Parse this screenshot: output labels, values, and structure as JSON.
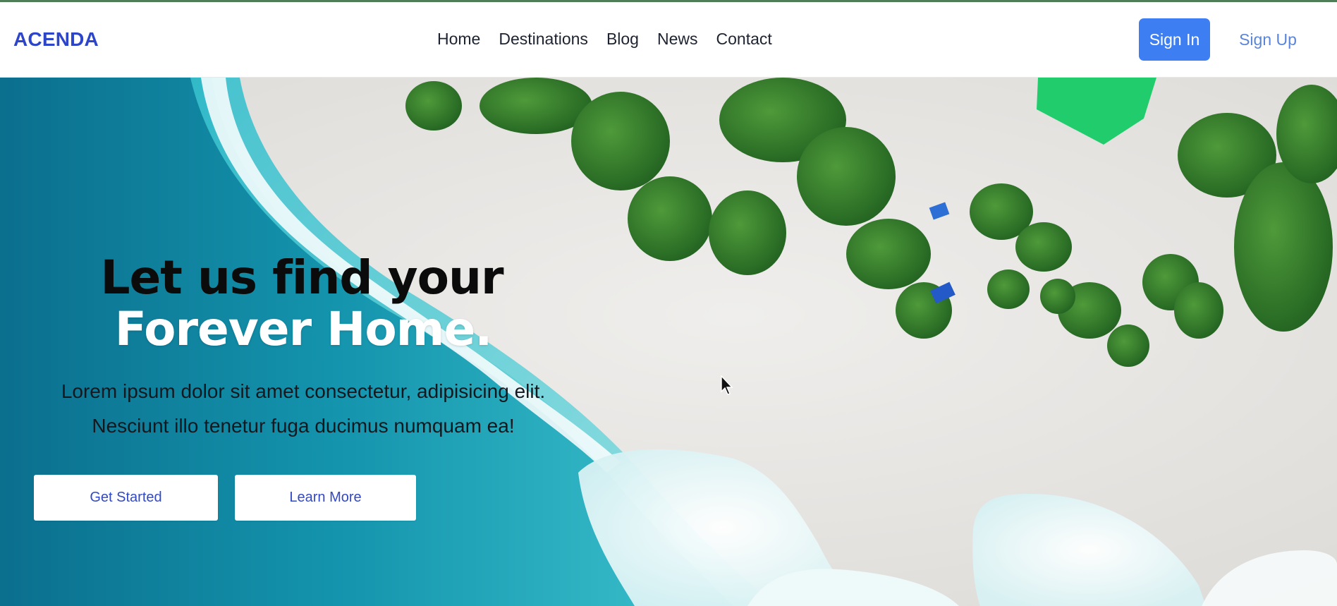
{
  "header": {
    "brand": "ACENDA",
    "nav": [
      "Home",
      "Destinations",
      "Blog",
      "News",
      "Contact"
    ],
    "sign_in": "Sign In",
    "sign_up": "Sign Up"
  },
  "hero": {
    "headline_line1": "Let us find your",
    "headline_line2": "Forever Home.",
    "lead": "Lorem ipsum dolor sit amet consectetur, adipisicing elit. Nesciunt illo tenetur fuga ducimus numquam ea!",
    "get_started": "Get Started",
    "learn_more": "Learn More",
    "background": "aerial-beach-photo"
  },
  "colors": {
    "brand": "#2d45c8",
    "primary_button": "#3d7ff3",
    "sign_up_link": "#5a85d8",
    "hero_button_text": "#3349c2"
  }
}
